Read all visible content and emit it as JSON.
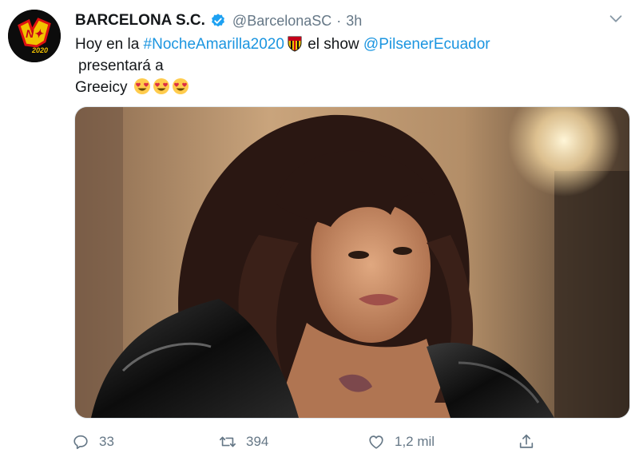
{
  "tweet": {
    "author": {
      "display_name": "BARCELONA S.C.",
      "handle": "@BarcelonaSC",
      "separator": "·",
      "time": "3h",
      "verified": true,
      "avatar_icon": "team-logo-avatar",
      "avatar_text": "2020"
    },
    "text": {
      "line1_prefix": "Hoy en la ",
      "hashtag": "#NocheAmarilla2020",
      "line1_middle": " el show ",
      "mention": "@PilsenerEcuador",
      "line2": "presentará a",
      "line3": "Greeicy"
    },
    "emojis": [
      "barcelona-crest-emoji",
      "heart-eyes-emoji",
      "heart-eyes-emoji",
      "heart-eyes-emoji"
    ],
    "media": {
      "type": "photo",
      "icon": "portrait-photo"
    },
    "actions": {
      "reply_count": "33",
      "retweet_count": "394",
      "like_count": "1,2 mil",
      "share_icon": "share-icon"
    },
    "colors": {
      "link": "#1b95e0",
      "verified": "#1da1f2",
      "muted": "#657786"
    }
  }
}
